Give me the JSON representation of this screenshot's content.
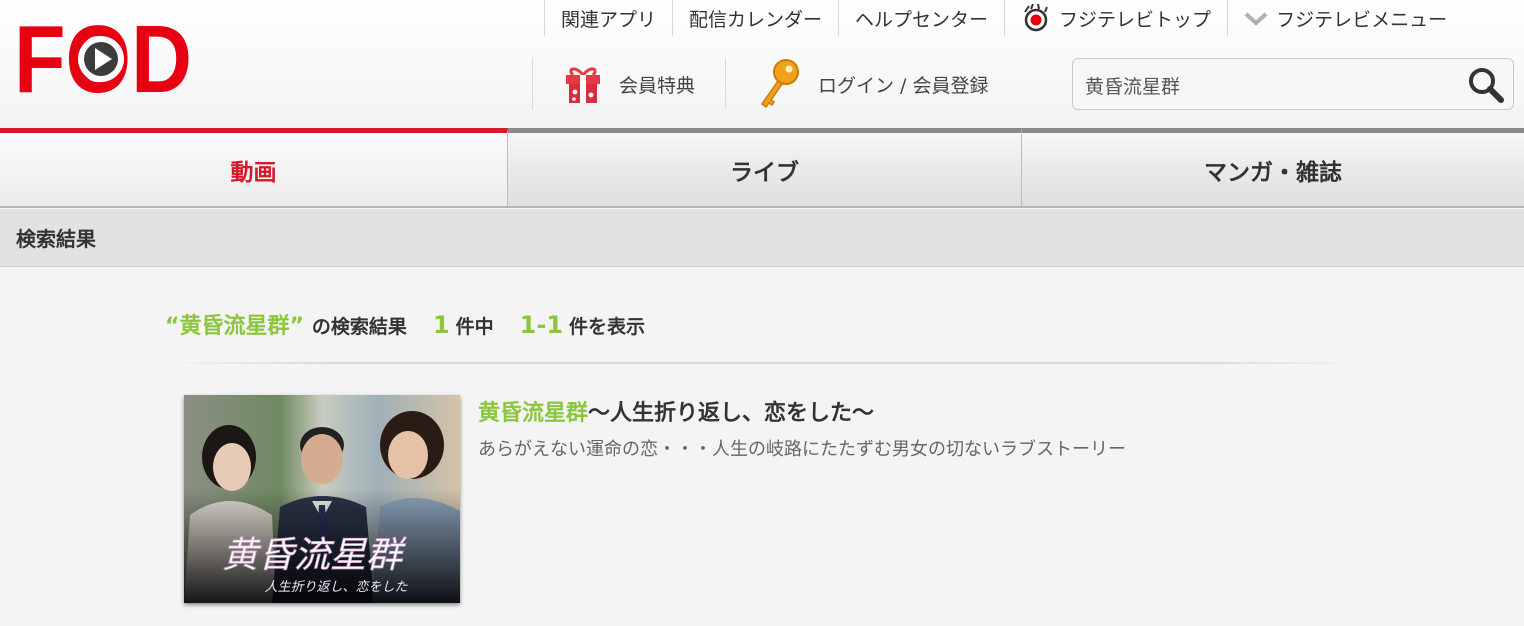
{
  "brand": {
    "logo_text": "FOD",
    "accent": "#e60012",
    "highlight": "#8cc63f"
  },
  "topnav": [
    {
      "label": "関連アプリ"
    },
    {
      "label": "配信カレンダー"
    },
    {
      "label": "ヘルプセンター"
    },
    {
      "label": "フジテレビトップ",
      "icon": "fujitv-eye-icon"
    },
    {
      "label": "フジテレビメニュー",
      "icon": "chevron-down-icon"
    }
  ],
  "subnav": {
    "benefits_label": "会員特典",
    "login_label": "ログイン / 会員登録"
  },
  "search": {
    "value": "黄昏流星群",
    "icon": "search-icon"
  },
  "tabs": [
    {
      "label": "動画",
      "active": true
    },
    {
      "label": "ライブ",
      "active": false
    },
    {
      "label": "マンガ・雑誌",
      "active": false
    }
  ],
  "section_title": "検索結果",
  "summary": {
    "query": "“黄昏流星群”",
    "suffix": "の検索結果",
    "total": "1",
    "total_unit": "件中",
    "range": "1-1",
    "range_unit": "件を表示"
  },
  "results": [
    {
      "title_highlight": "黄昏流星群",
      "title_rest": "〜人生折り返し、恋をした〜",
      "description": "あらがえない運命の恋・・・人生の岐路にたたずむ男女の切ないラブストーリー",
      "thumb_title": "黄昏流星群",
      "thumb_subtitle": "人生折り返し、恋をした"
    }
  ]
}
